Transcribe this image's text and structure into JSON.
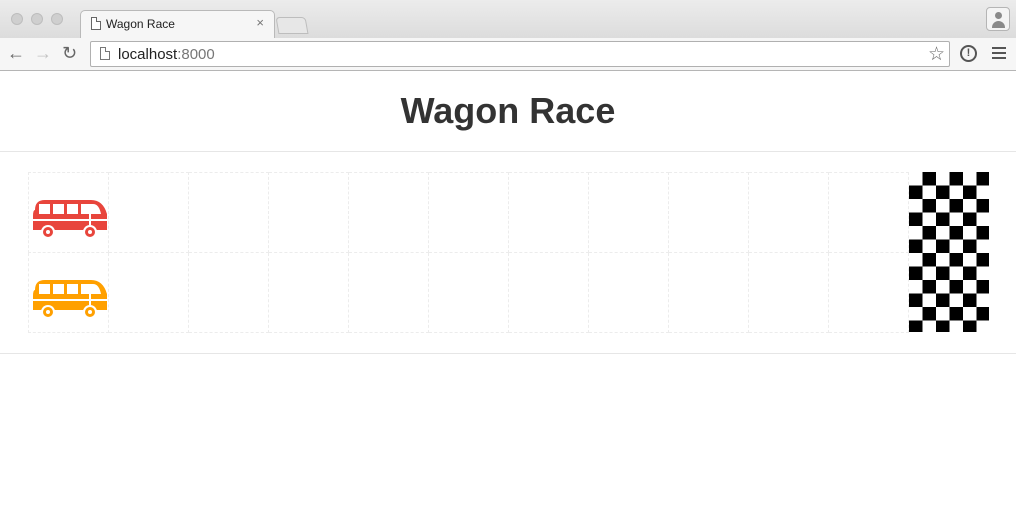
{
  "browser": {
    "tab_title": "Wagon Race",
    "tab_close": "×",
    "url_host": "localhost",
    "url_rest": ":8000",
    "back": "←",
    "forward": "→",
    "reload": "↻",
    "star": "☆",
    "info": "!"
  },
  "page": {
    "title": "Wagon Race"
  },
  "race": {
    "track_cells_per_lane": 12,
    "lanes": [
      {
        "player": 1,
        "wagon_color": "#e8453c",
        "position": 0
      },
      {
        "player": 2,
        "wagon_color": "#ffa000",
        "position": 0
      }
    ],
    "finish_icon": "checkered-flag"
  }
}
